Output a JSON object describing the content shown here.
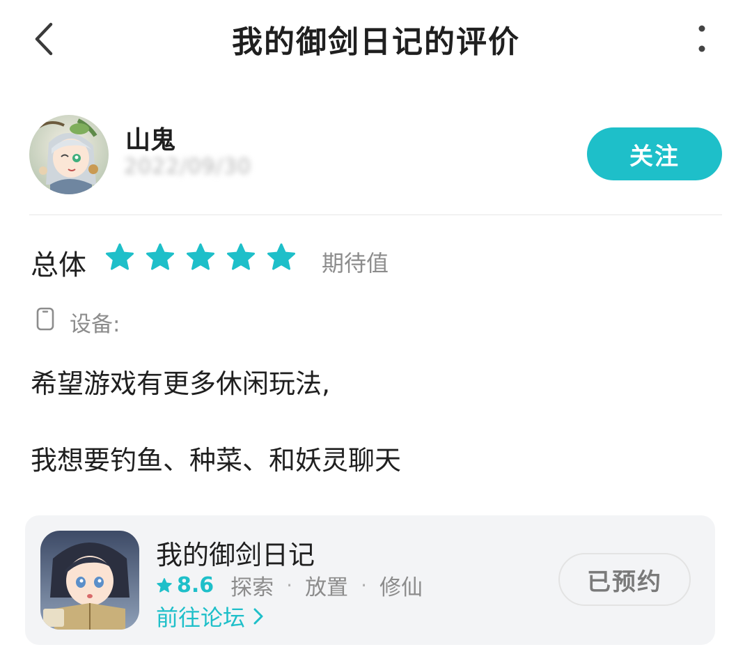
{
  "header": {
    "title": "我的御剑日记的评价",
    "back_icon": "chevron-left-icon",
    "more_icon": "more-vertical-icon"
  },
  "user": {
    "name": "山鬼",
    "date": "2022/09/30",
    "follow_label": "关注"
  },
  "rating": {
    "label": "总体",
    "stars": 5,
    "max_stars": 5,
    "type_label": "期待值",
    "star_color": "#1ebfc9"
  },
  "device": {
    "icon": "phone-icon",
    "label": "设备:"
  },
  "review": {
    "lines": [
      "希望游戏有更多休闲玩法,",
      "我想要钓鱼、种菜、和妖灵聊天"
    ]
  },
  "game_card": {
    "name": "我的御剑日记",
    "score": "8.6",
    "tags": [
      "探索",
      "放置",
      "修仙"
    ],
    "separator": "·",
    "forum_label": "前往论坛",
    "reserve_label": "已预约"
  },
  "colors": {
    "accent": "#1ebfc9",
    "text_primary": "#1f1f1f",
    "text_secondary": "#8c8c8c",
    "card_bg": "#f3f4f6"
  }
}
